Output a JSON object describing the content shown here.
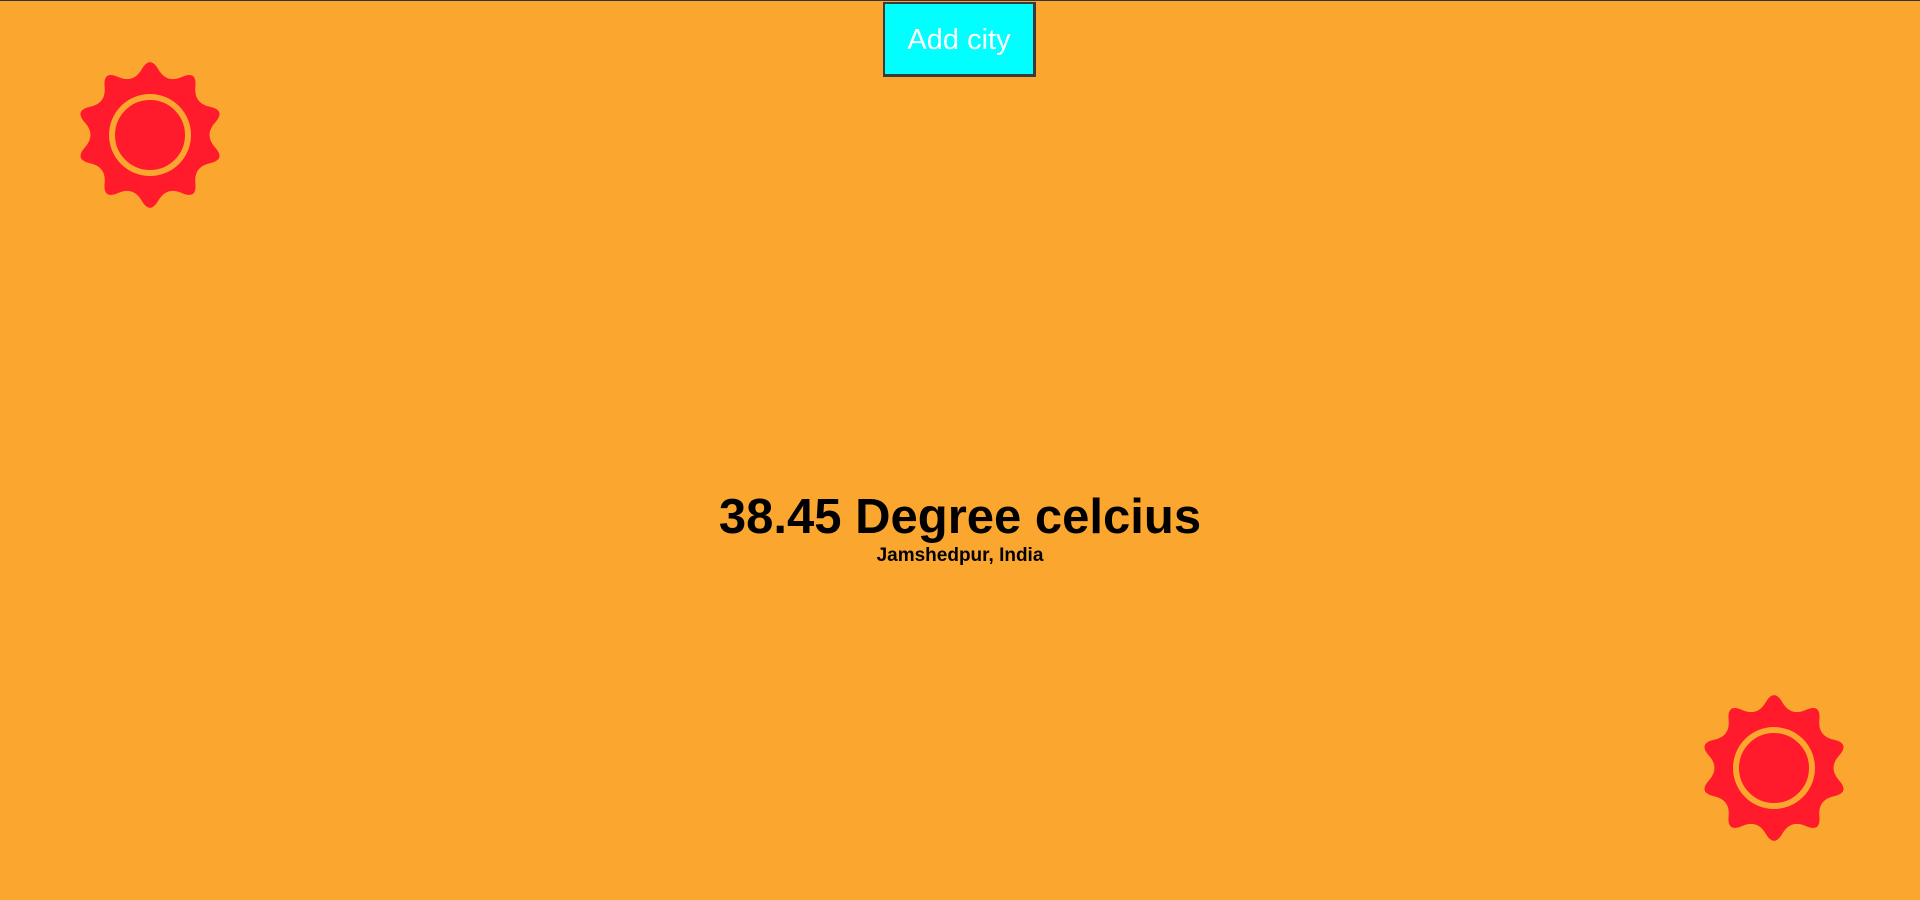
{
  "colors": {
    "background": "#FBA72F",
    "button_bg": "#00FFFF",
    "button_text": "#FFFFFF",
    "sun": "#FF1A2C"
  },
  "toolbar": {
    "add_city_label": "Add city"
  },
  "weather": {
    "temperature": "38.45 Degree celcius",
    "location": "Jamshedpur, India"
  },
  "icons": {
    "top_left": "sun-icon",
    "bottom_right": "sun-icon"
  }
}
